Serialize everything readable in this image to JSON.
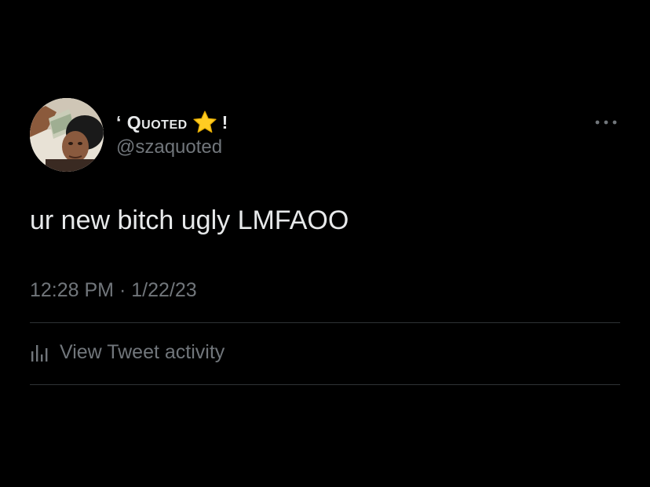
{
  "tweet": {
    "author": {
      "display_name_prefix": "‘ ",
      "display_name_word": "Quoted",
      "display_name_suffix": "!",
      "emoji": "star-icon",
      "handle": "@szaquoted",
      "avatar": "avatar"
    },
    "text": "ur new bitch ugly LMFAOO",
    "timestamp": "12:28 PM · 1/22/23",
    "activity_label": "View Tweet activity"
  },
  "colors": {
    "background": "#000000",
    "primary_text": "#e7e9ea",
    "secondary_text": "#71767b",
    "divider": "#2f3336",
    "star": "#ffcc22"
  }
}
